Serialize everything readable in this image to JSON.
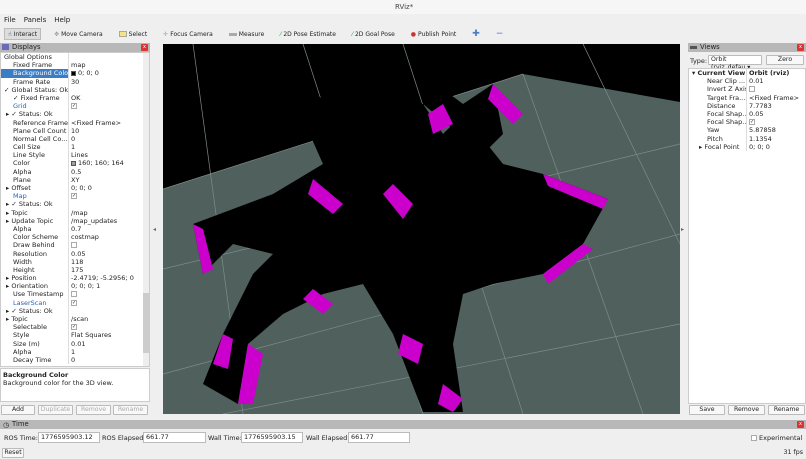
{
  "window": {
    "title": "RViz*"
  },
  "menu": [
    "File",
    "Panels",
    "Help"
  ],
  "toolbar": [
    "Interact",
    "Move Camera",
    "Select",
    "Focus Camera",
    "Measure",
    "2D Pose Estimate",
    "2D Goal Pose",
    "Publish Point"
  ],
  "displays": {
    "title": "Displays",
    "rows": [
      {
        "k": "Global Options",
        "v": "",
        "cls": "",
        "ind": 3
      },
      {
        "k": "Fixed Frame",
        "v": "map",
        "ind": 12
      },
      {
        "k": "Background Color",
        "v": "0; 0; 0",
        "ind": 12,
        "cls": "sel",
        "swatch": "#000000"
      },
      {
        "k": "Frame Rate",
        "v": "30",
        "ind": 12
      },
      {
        "k": "✓ Global Status: Ok",
        "v": "",
        "ind": 3
      },
      {
        "k": "✓ Fixed Frame",
        "v": "OK",
        "ind": 12
      },
      {
        "k": "Grid",
        "v": "",
        "ind": 12,
        "cls": "blue",
        "check": true
      },
      {
        "k": "▸ ✓ Status: Ok",
        "v": "",
        "ind": 5
      },
      {
        "k": "Reference Frame",
        "v": "<Fixed Frame>",
        "ind": 12
      },
      {
        "k": "Plane Cell Count",
        "v": "10",
        "ind": 12
      },
      {
        "k": "Normal Cell Co...",
        "v": "0",
        "ind": 12
      },
      {
        "k": "Cell Size",
        "v": "1",
        "ind": 12
      },
      {
        "k": "Line Style",
        "v": "Lines",
        "ind": 12
      },
      {
        "k": "Color",
        "v": "160; 160; 164",
        "ind": 12,
        "swatch": "#a0a0a4"
      },
      {
        "k": "Alpha",
        "v": "0.5",
        "ind": 12
      },
      {
        "k": "Plane",
        "v": "XY",
        "ind": 12
      },
      {
        "k": "▸ Offset",
        "v": "0; 0; 0",
        "ind": 5
      },
      {
        "k": "Map",
        "v": "",
        "ind": 12,
        "cls": "blue",
        "check": true
      },
      {
        "k": "▸ ✓ Status: Ok",
        "v": "",
        "ind": 5
      },
      {
        "k": "▸ Topic",
        "v": "/map",
        "ind": 5
      },
      {
        "k": "▸ Update Topic",
        "v": "/map_updates",
        "ind": 5
      },
      {
        "k": "Alpha",
        "v": "0.7",
        "ind": 12
      },
      {
        "k": "Color Scheme",
        "v": "costmap",
        "ind": 12
      },
      {
        "k": "Draw Behind",
        "v": "",
        "ind": 12,
        "check": false
      },
      {
        "k": "Resolution",
        "v": "0.05",
        "ind": 12
      },
      {
        "k": "Width",
        "v": "118",
        "ind": 12
      },
      {
        "k": "Height",
        "v": "175",
        "ind": 12
      },
      {
        "k": "▸ Position",
        "v": "-2.4719; -5.2956; 0",
        "ind": 5
      },
      {
        "k": "▸ Orientation",
        "v": "0; 0; 0; 1",
        "ind": 5
      },
      {
        "k": "Use Timestamp",
        "v": "",
        "ind": 12,
        "check": false
      },
      {
        "k": "LaserScan",
        "v": "",
        "ind": 12,
        "cls": "blue",
        "check": true
      },
      {
        "k": "▸ ✓ Status: Ok",
        "v": "",
        "ind": 5
      },
      {
        "k": "▸ Topic",
        "v": "/scan",
        "ind": 5
      },
      {
        "k": "Selectable",
        "v": "",
        "ind": 12,
        "check": true
      },
      {
        "k": "Style",
        "v": "Flat Squares",
        "ind": 12
      },
      {
        "k": "Size (m)",
        "v": "0.01",
        "ind": 12
      },
      {
        "k": "Alpha",
        "v": "1",
        "ind": 12
      },
      {
        "k": "Decay Time",
        "v": "0",
        "ind": 12
      }
    ],
    "desc_title": "Background Color",
    "desc_text": "Background color for the 3D view.",
    "buttons": [
      "Add",
      "Duplicate",
      "Remove",
      "Rename"
    ]
  },
  "views": {
    "title": "Views",
    "type_label": "Type:",
    "type_value": "Orbit (rviz_defau",
    "zero": "Zero",
    "rows": [
      {
        "k": "▾ Current View",
        "v": "Orbit (rviz)",
        "ind": 3,
        "bold": true
      },
      {
        "k": "Near Clip ...",
        "v": "0.01",
        "ind": 18
      },
      {
        "k": "Invert Z Axis",
        "v": "",
        "ind": 18,
        "check": false
      },
      {
        "k": "Target Fra...",
        "v": "<Fixed Frame>",
        "ind": 18
      },
      {
        "k": "Distance",
        "v": "7.7783",
        "ind": 18
      },
      {
        "k": "Focal Shap...",
        "v": "0.05",
        "ind": 18
      },
      {
        "k": "Focal Shap...",
        "v": "",
        "ind": 18,
        "check": true
      },
      {
        "k": "Yaw",
        "v": "5.87858",
        "ind": 18
      },
      {
        "k": "Pitch",
        "v": "1.1354",
        "ind": 18
      },
      {
        "k": "▸ Focal Point",
        "v": "0; 0; 0",
        "ind": 10
      }
    ],
    "buttons": [
      "Save",
      "Remove",
      "Rename"
    ]
  },
  "time": {
    "title": "Time",
    "ros_time_label": "ROS Time:",
    "ros_time": "1776595903.12",
    "ros_elapsed_label": "ROS Elapsed:",
    "ros_elapsed": "661.77",
    "wall_time_label": "Wall Time:",
    "wall_time": "1776595903.15",
    "wall_elapsed_label": "Wall Elapsed:",
    "wall_elapsed": "661.77",
    "experimental": "Experimental",
    "reset": "Reset",
    "fps": "31 fps"
  },
  "colors": {
    "plane": "#4f605d",
    "scan": "#cc00cc",
    "selection": "#3a7cc5"
  }
}
